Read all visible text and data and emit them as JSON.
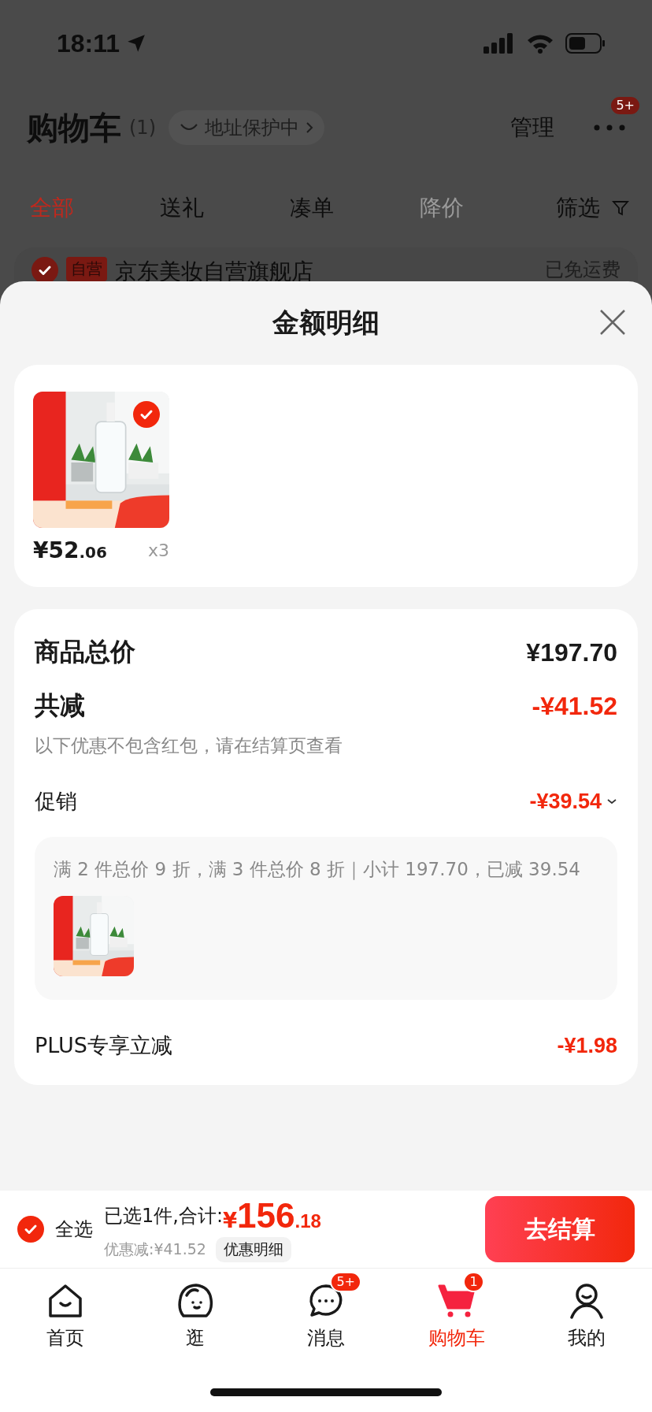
{
  "status_bar": {
    "time": "18:11"
  },
  "header": {
    "title": "购物车",
    "count": "(1)",
    "address_badge": "地址保护中",
    "manage": "管理",
    "more_badge": "5+"
  },
  "filter_tabs": [
    {
      "label": "全部",
      "selected": true,
      "disabled": false
    },
    {
      "label": "送礼",
      "selected": false,
      "disabled": false
    },
    {
      "label": "凑单",
      "selected": false,
      "disabled": false
    },
    {
      "label": "降价",
      "selected": false,
      "disabled": true
    }
  ],
  "filter_label": "筛选",
  "shop": {
    "checked": true,
    "tag": "自营",
    "name": "京东美妆自营旗舰店",
    "shipping": "已免运费"
  },
  "sheet": {
    "title": "金额明细",
    "items": [
      {
        "kind": "picture",
        "checked": true,
        "price_main": "¥52",
        "price_cents": ".06",
        "quantity": "x3"
      }
    ],
    "goods": {
      "label": "商品总价",
      "value": "¥197.70"
    },
    "reduce": {
      "label": "共减",
      "value": "-¥41.52",
      "note": "以下优惠不包含红包，请在结算页查看"
    },
    "promotion": {
      "label": "促销",
      "value": "-¥39.54",
      "expanded": true,
      "description": "满 2 件总价 9 折，满 3 件总价 8 折｜小计 197.70，已减 39.54"
    },
    "plus": {
      "label": "PLUS专享立减",
      "value": "-¥1.98"
    }
  },
  "checkout": {
    "select_all": {
      "label": "全选",
      "checked": true
    },
    "selected_text": "已选1件,合计:",
    "currency": "¥",
    "total_main": "156",
    "total_cents": ".18",
    "discount": "优惠减:¥41.52",
    "detail_button": "优惠明细",
    "submit": "去结算"
  },
  "nav": [
    {
      "kind": "home",
      "label": "首页",
      "selected": false
    },
    {
      "kind": "browse",
      "label": "逛",
      "selected": false
    },
    {
      "kind": "message",
      "label": "消息",
      "selected": false,
      "badge": "5+"
    },
    {
      "kind": "cart",
      "label": "购物车",
      "selected": true,
      "badge": "1"
    },
    {
      "kind": "profile",
      "label": "我的",
      "selected": false
    }
  ]
}
